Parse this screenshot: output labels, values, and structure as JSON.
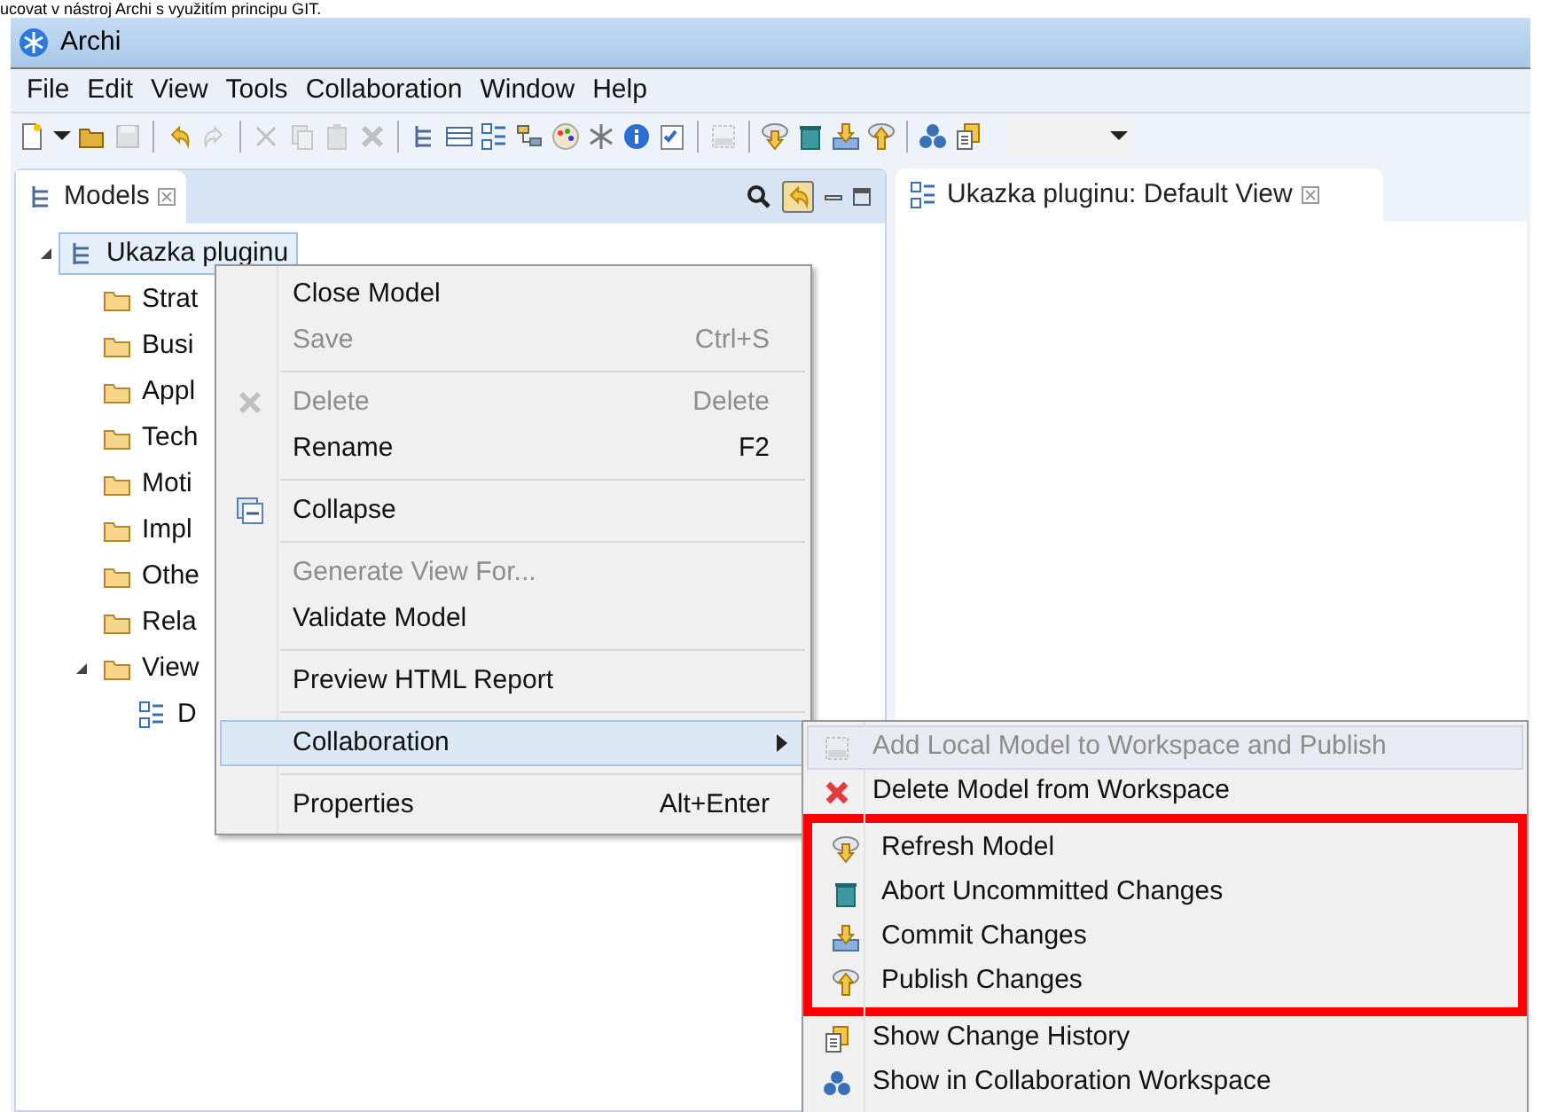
{
  "caption": "ucovat v nástroj Archi s využitím principu GIT.",
  "window": {
    "title": "Archi"
  },
  "menu_bar": [
    "File",
    "Edit",
    "View",
    "Tools",
    "Collaboration",
    "Window",
    "Help"
  ],
  "toolbar": [
    {
      "kind": "new"
    },
    {
      "kind": "dropdown"
    },
    {
      "kind": "open"
    },
    {
      "kind": "save",
      "disabled": true
    },
    {
      "kind": "sep"
    },
    {
      "kind": "undo"
    },
    {
      "kind": "redo",
      "disabled": true
    },
    {
      "kind": "sep"
    },
    {
      "kind": "cut",
      "disabled": true
    },
    {
      "kind": "copy",
      "disabled": true
    },
    {
      "kind": "paste",
      "disabled": true
    },
    {
      "kind": "delete",
      "disabled": true
    },
    {
      "kind": "sep"
    },
    {
      "kind": "tree"
    },
    {
      "kind": "table"
    },
    {
      "kind": "outline"
    },
    {
      "kind": "hierarchy"
    },
    {
      "kind": "palette"
    },
    {
      "kind": "snow"
    },
    {
      "kind": "info"
    },
    {
      "kind": "check"
    },
    {
      "kind": "sep"
    },
    {
      "kind": "git",
      "disabled": true
    },
    {
      "kind": "sep"
    },
    {
      "kind": "cloud-down"
    },
    {
      "kind": "trash"
    },
    {
      "kind": "commit"
    },
    {
      "kind": "cloud-up"
    },
    {
      "kind": "sep"
    },
    {
      "kind": "circles"
    },
    {
      "kind": "history"
    }
  ],
  "models_tab": {
    "label": "Models"
  },
  "editor_tab": {
    "label": "Ukazka pluginu: Default View"
  },
  "tree": [
    {
      "label": "Ukazka pluginu",
      "kind": "model",
      "expanded": true,
      "selected": true,
      "children": [
        {
          "label": "Strat",
          "kind": "folder"
        },
        {
          "label": "Busi",
          "kind": "folder"
        },
        {
          "label": "Appl",
          "kind": "folder"
        },
        {
          "label": "Tech",
          "kind": "folder"
        },
        {
          "label": "Moti",
          "kind": "folder"
        },
        {
          "label": "Impl",
          "kind": "folder"
        },
        {
          "label": "Othe",
          "kind": "folder"
        },
        {
          "label": "Rela",
          "kind": "folder"
        },
        {
          "label": "View",
          "kind": "folder",
          "expanded": true,
          "children": [
            {
              "label": "D",
              "kind": "view"
            }
          ]
        }
      ]
    }
  ],
  "context_menu": [
    {
      "kind": "item",
      "label": "Close Model",
      "disabled": false,
      "highlighted": false
    },
    {
      "kind": "item",
      "label": "Save",
      "shortcut": "Ctrl+S",
      "disabled": true,
      "highlighted": false
    },
    {
      "kind": "separator"
    },
    {
      "kind": "delete",
      "label": "Delete",
      "shortcut": "Delete",
      "disabled": true,
      "highlighted": false
    },
    {
      "kind": "item",
      "label": "Rename",
      "shortcut": "F2",
      "disabled": false,
      "highlighted": false
    },
    {
      "kind": "separator"
    },
    {
      "kind": "collapse",
      "label": "Collapse",
      "disabled": false,
      "highlighted": false
    },
    {
      "kind": "separator"
    },
    {
      "kind": "item",
      "label": "Generate View For...",
      "disabled": true,
      "highlighted": false
    },
    {
      "kind": "item",
      "label": "Validate Model",
      "disabled": false,
      "highlighted": false
    },
    {
      "kind": "separator"
    },
    {
      "kind": "item",
      "label": "Preview HTML Report",
      "disabled": false,
      "highlighted": false
    },
    {
      "kind": "separator"
    },
    {
      "kind": "item",
      "label": "Collaboration",
      "submenu": true,
      "disabled": false,
      "highlighted": true
    },
    {
      "kind": "separator"
    },
    {
      "kind": "item",
      "label": "Properties",
      "shortcut": "Alt+Enter",
      "disabled": false,
      "highlighted": false
    }
  ],
  "submenu": [
    {
      "label": "Add Local Model to Workspace and Publish",
      "kind": "git",
      "disabled": true,
      "highlighted": true,
      "marked": false
    },
    {
      "label": "Delete Model from Workspace",
      "kind": "red-x",
      "disabled": false,
      "highlighted": false,
      "marked": false
    },
    {
      "label": "Refresh Model",
      "kind": "cloud-down",
      "disabled": false,
      "highlighted": false,
      "marked": true
    },
    {
      "label": "Abort Uncommitted Changes",
      "kind": "trash",
      "disabled": false,
      "highlighted": false,
      "marked": true
    },
    {
      "label": "Commit Changes",
      "kind": "commit",
      "disabled": false,
      "highlighted": false,
      "marked": true
    },
    {
      "label": "Publish Changes",
      "kind": "cloud-up",
      "disabled": false,
      "highlighted": false,
      "marked": true
    },
    {
      "label": "Show Change History",
      "kind": "history",
      "disabled": false,
      "highlighted": false,
      "marked": false
    },
    {
      "label": "Show in Collaboration Workspace",
      "kind": "circles",
      "disabled": false,
      "highlighted": false,
      "marked": false
    }
  ]
}
